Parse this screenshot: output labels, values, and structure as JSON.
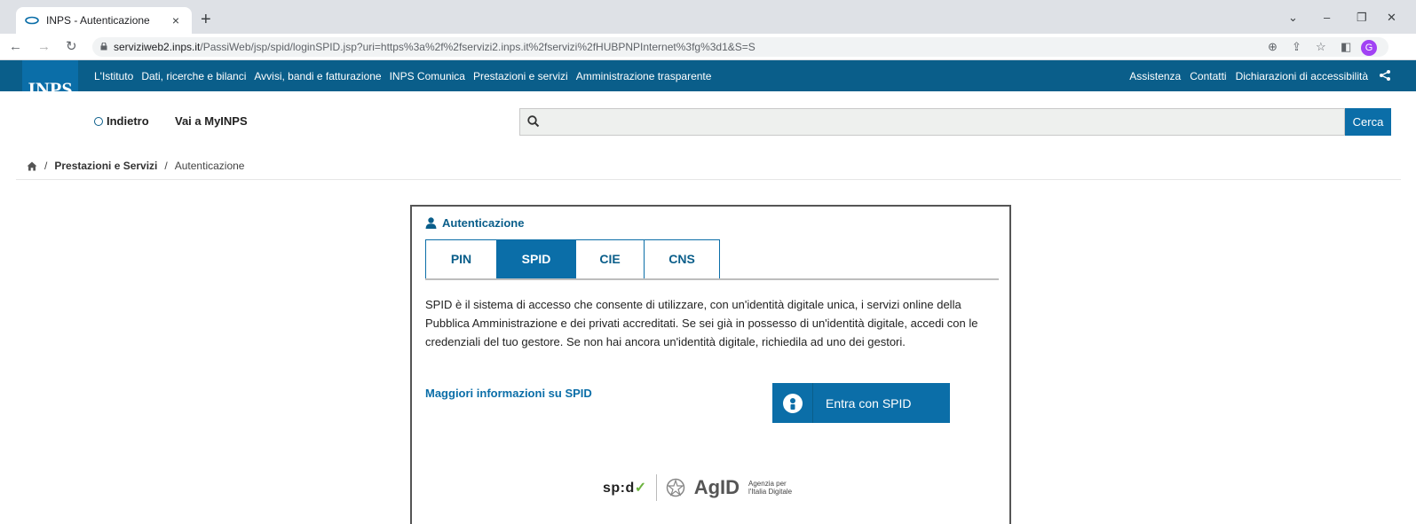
{
  "browser": {
    "tab_title": "INPS - Autenticazione",
    "tab_close": "×",
    "new_tab": "+",
    "url_host": "serviziweb2.inps.it",
    "url_path": "/PassiWeb/jsp/spid/loginSPID.jsp?uri=https%3a%2f%2fservizi2.inps.it%2fservizi%2fHUBPNPInternet%3fg%3d1&S=S",
    "profile_initial": "G"
  },
  "topnav": {
    "links": [
      "L'Istituto",
      "Dati, ricerche e bilanci",
      "Avvisi, bandi e fatturazione",
      "INPS Comunica",
      "Prestazioni e servizi",
      "Amministrazione trasparente"
    ],
    "right_links": [
      "Assistenza",
      "Contatti",
      "Dichiarazioni di accessibilità"
    ]
  },
  "logo_text": "INPS",
  "subheader": {
    "back_label": "Indietro",
    "myinps_label": "Vai a MyINPS",
    "search_placeholder": "",
    "search_button": "Cerca"
  },
  "breadcrumb": {
    "separator": "/",
    "items": [
      "Prestazioni e Servizi",
      "Autenticazione"
    ]
  },
  "panel": {
    "title": "Autenticazione",
    "tabs": [
      "PIN",
      "SPID",
      "CIE",
      "CNS"
    ],
    "active_tab": "SPID",
    "description": "SPID è il sistema di accesso che consente di utilizzare, con un'identità digitale unica, i servizi online della Pubblica Amministrazione e dei privati accreditati. Se sei già in possesso di un'identità digitale, accedi con le credenziali del tuo gestore. Se non hai ancora un'identità digitale, richiedila ad uno dei gestori.",
    "more_info": "Maggiori informazioni su SPID",
    "spid_button": "Entra con SPID",
    "logo_spid": "sp:d",
    "logo_agid": "AgID",
    "logo_agid_sub1": "Agenzia per",
    "logo_agid_sub2": "l'Italia Digitale"
  },
  "colors": {
    "inps_blue": "#0b6ea8",
    "nav_blue": "#0a5e8a"
  }
}
